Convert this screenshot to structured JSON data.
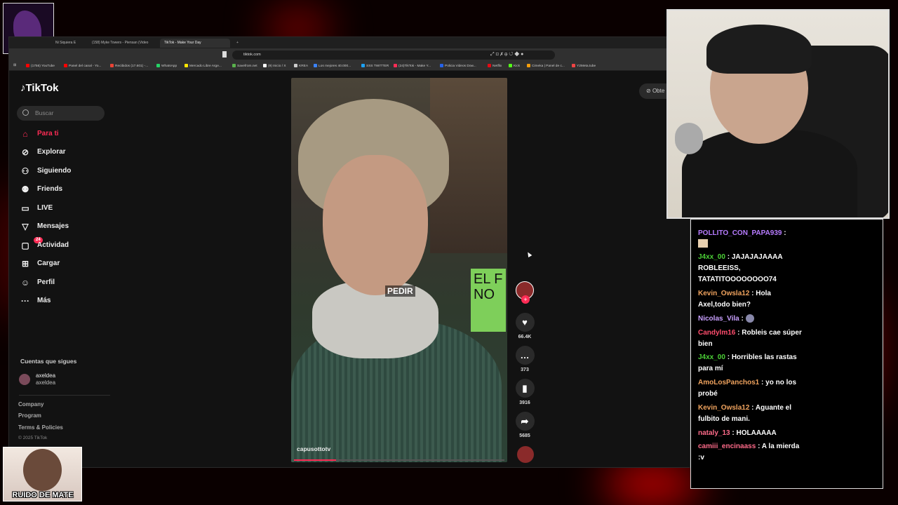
{
  "browser": {
    "tabs": [
      {
        "label": "Ni Siquiera E",
        "active": false
      },
      {
        "label": "(158) Myke Towers - Piensan (Video",
        "active": false
      },
      {
        "label": "TikTok - Make Your Day",
        "active": true
      }
    ],
    "url": "tiktok.com",
    "bookmarks": [
      {
        "label": "(1756) YouTube",
        "color": "#ff0000"
      },
      {
        "label": "Panel del canal - Yo...",
        "color": "#ff0000"
      },
      {
        "label": "Recibidos (17.601) -...",
        "color": "#ea4335"
      },
      {
        "label": "WhatsApp",
        "color": "#25d366"
      },
      {
        "label": "Mercado Libre Arge...",
        "color": "#ffe600"
      },
      {
        "label": "Savefrom.net",
        "color": "#59b14c"
      },
      {
        "label": "(9) Inicio / X",
        "color": "#ffffff"
      },
      {
        "label": "KREA",
        "color": "#cccccc"
      },
      {
        "label": "Los mejores 40.000...",
        "color": "#3b82f6"
      },
      {
        "label": "SSS TWITTER",
        "color": "#1da1f2"
      },
      {
        "label": "(24)TikTok - Make Y...",
        "color": "#fe2c55"
      },
      {
        "label": "Policia Videos Dow...",
        "color": "#2563eb"
      },
      {
        "label": "Netflix",
        "color": "#e50914"
      },
      {
        "label": "Kick",
        "color": "#53fc18"
      },
      {
        "label": "Cimeka | Panel de c...",
        "color": "#f59e0b"
      },
      {
        "label": "Y2Meta.tube",
        "color": "#ef4444"
      }
    ]
  },
  "tiktok": {
    "logo": "TikTok",
    "search_placeholder": "Buscar",
    "nav": [
      {
        "label": "Para ti",
        "icon": "home-icon",
        "active": true
      },
      {
        "label": "Explorar",
        "icon": "compass-icon",
        "active": false
      },
      {
        "label": "Siguiendo",
        "icon": "user-follow-icon",
        "active": false
      },
      {
        "label": "Friends",
        "icon": "friends-icon",
        "active": false
      },
      {
        "label": "LIVE",
        "icon": "live-icon",
        "active": false
      },
      {
        "label": "Mensajes",
        "icon": "send-icon",
        "active": false
      },
      {
        "label": "Actividad",
        "icon": "inbox-icon",
        "active": false
      },
      {
        "label": "Cargar",
        "icon": "upload-icon",
        "active": false
      },
      {
        "label": "Perfil",
        "icon": "profile-icon",
        "active": false
      },
      {
        "label": "Más",
        "icon": "more-icon",
        "active": false
      }
    ],
    "activity_badge": "24",
    "following_heading": "Cuentas que sigues",
    "following": [
      {
        "name": "axeldea",
        "handle": "axeldea"
      }
    ],
    "footer_links": [
      "Company",
      "Program",
      "Terms & Policies"
    ],
    "copyright": "© 2025 TikTok",
    "get_app": "Obte",
    "video": {
      "caption": "PEDIR",
      "author": "capusottotv",
      "sign_text": "EL F NO"
    },
    "actions": {
      "likes": "66.4K",
      "comments": "373",
      "saves": "3916",
      "shares": "5685"
    }
  },
  "chat": [
    {
      "user": "POLLITO_CON_PAPA939",
      "text": ":",
      "color": "#b77cff"
    },
    {
      "user": "J4xx_00",
      "text": ": JAJAJAJAAAA ROBLEEISS, TATATITOOOOOOOO74",
      "color": "#4cd137"
    },
    {
      "user": "Kevin_Owsla12",
      "text": ": Hola Axel,todo bien?",
      "color": "#f0a35e"
    },
    {
      "user": "Nicolas_Vila",
      "text": ":",
      "color": "#c9a0ff"
    },
    {
      "user": "Candylm16",
      "text": ": Robleis cae súper bien",
      "color": "#ff4d6d"
    },
    {
      "user": "J4xx_00",
      "text": ": Horribles las rastas para mí",
      "color": "#4cd137"
    },
    {
      "user": "AmoLosPanchos1",
      "text": ": yo no los probé",
      "color": "#f0a35e"
    },
    {
      "user": "Kevin_Owsla12",
      "text": ": Aguante el fulbito de mani.",
      "color": "#f0a35e"
    },
    {
      "user": "nataly_13",
      "text": ": HOLAAAAA",
      "color": "#ff6b8a"
    },
    {
      "user": "camiii_encinaass",
      "text": ": A la mierda :v",
      "color": "#ff6b8a"
    }
  ],
  "overlay": {
    "mate_text": "RUIDO DE MATE"
  }
}
